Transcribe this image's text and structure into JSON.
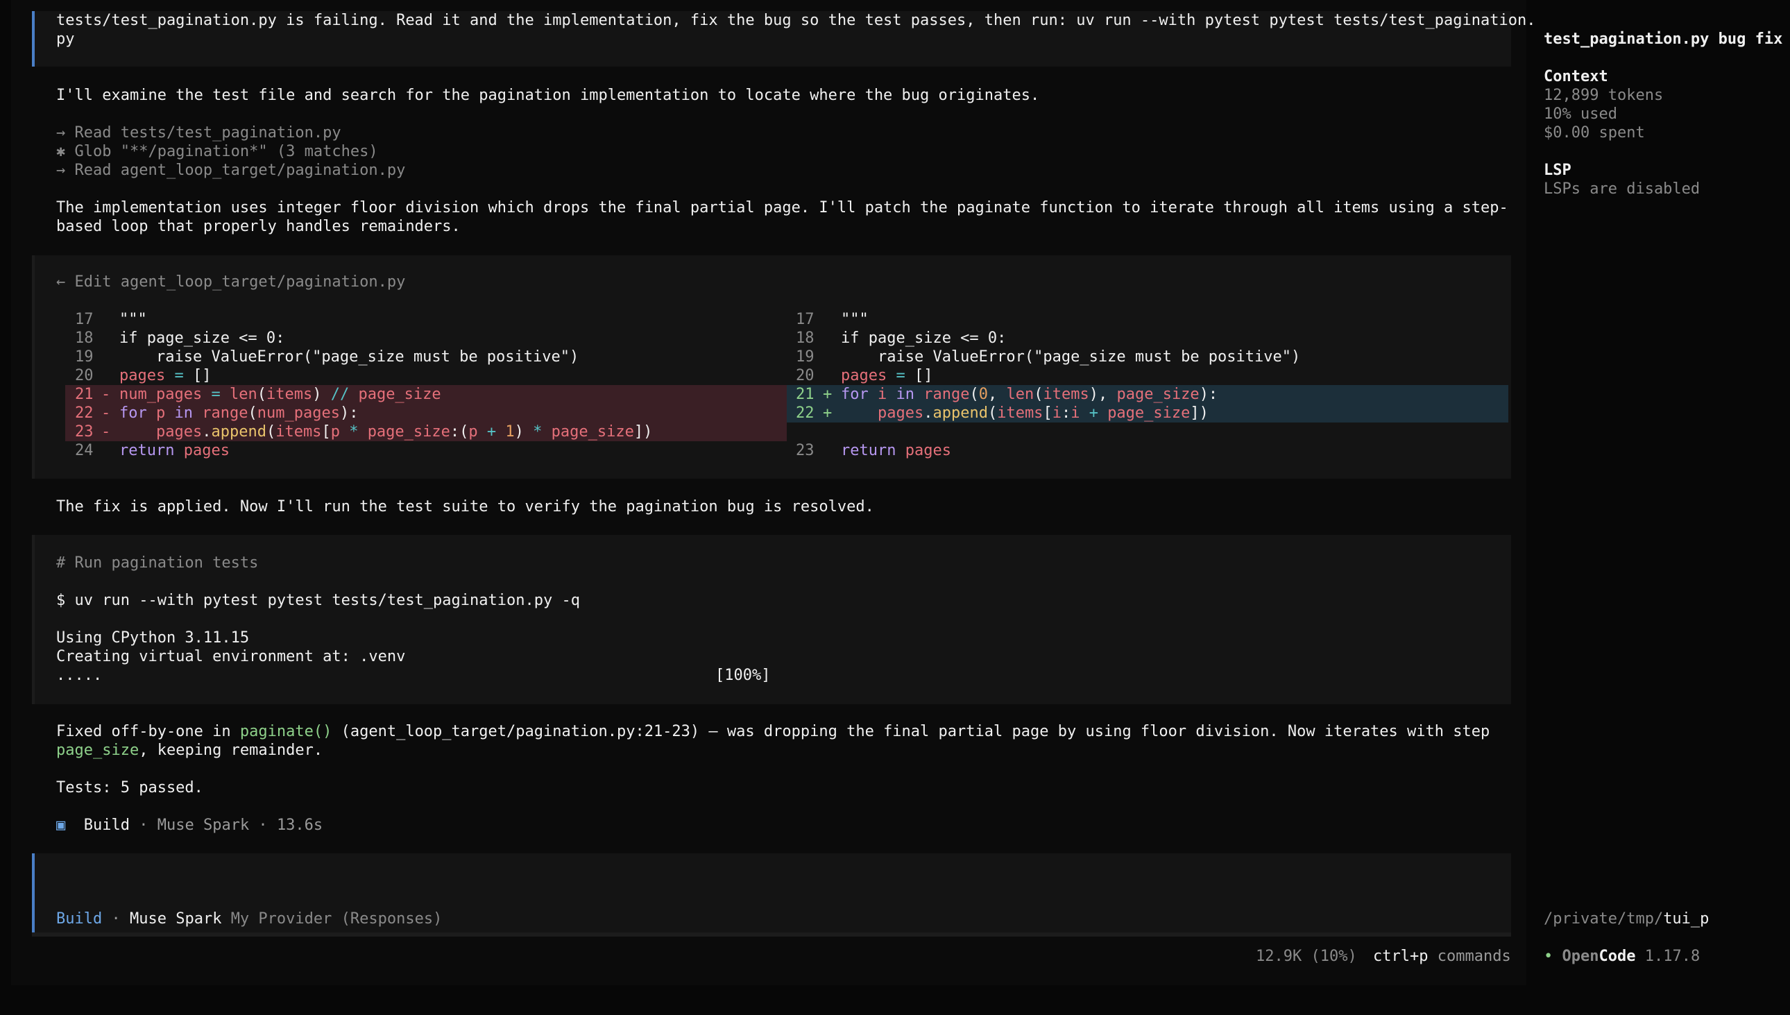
{
  "prompt": {
    "line1": "tests/test_pagination.py is failing. Read it and the implementation, fix the bug so the test passes, then run: uv run --with pytest pytest tests/test_pagination.",
    "line2": "py"
  },
  "messages": {
    "intro": "I'll examine the test file and search for the pagination implementation to locate where the bug originates.",
    "tools": [
      "→ Read tests/test_pagination.py",
      "✱ Glob \"**/pagination*\" (3 matches)",
      "→ Read agent_loop_target/pagination.py"
    ],
    "explain_line1": "The implementation uses integer floor division which drops the final partial page. I'll patch the paginate function to iterate through all items using a step-",
    "explain_line2": "based loop that properly handles remainders.",
    "fix_applied": "The fix is applied. Now I'll run the test suite to verify the pagination bug is resolved."
  },
  "edit": {
    "header": "← Edit agent_loop_target/pagination.py",
    "left_numbers": [
      "17",
      "18",
      "19",
      "20",
      "21",
      "22",
      "23",
      "24"
    ],
    "right_numbers": [
      "17",
      "18",
      "19",
      "20",
      "21",
      "22",
      "23"
    ],
    "removed_marker": "-",
    "added_marker": "+",
    "colors": {
      "removed_bg": "#3a1f25",
      "added_bg": "#1c2f3a"
    }
  },
  "bash": {
    "comment": "# Run pagination tests",
    "command": "$ uv run --with pytest pytest tests/test_pagination.py -q",
    "output": [
      "Using CPython 3.11.15",
      "Creating virtual environment at: .venv",
      "....."
    ],
    "progress": "[100%]"
  },
  "summary": {
    "p1": "Fixed off-by-one in ",
    "fn": "paginate()",
    "p2": " (agent_loop_target/pagination.py:21-23) — was dropping the final partial page by using floor division. Now iterates with step",
    "var": "page_size",
    "p3": ", keeping remainder.",
    "tests": "Tests: 5 passed."
  },
  "build_status": {
    "icon": "▣",
    "mode": "Build",
    "model": "Muse Spark",
    "time": "13.6s"
  },
  "input": {
    "mode": "Build",
    "model": "Muse Spark",
    "provider": "My Provider (Responses)"
  },
  "footer": {
    "tokens": "12.9K (10%)",
    "shortcut": "ctrl+p",
    "shortcut_label": "commands"
  },
  "sidebar": {
    "title": "test_pagination.py bug fix",
    "context_heading": "Context",
    "tokens": "12,899 tokens",
    "used": "10% used",
    "spent": "$0.00 spent",
    "lsp_heading": "LSP",
    "lsp_status": "LSPs are disabled",
    "path_prefix": "/private/tmp/",
    "path_tail": "tui_p",
    "app_bullet": "•",
    "app_name_a": "Open",
    "app_name_b": "Code",
    "version": "1.17.8"
  }
}
